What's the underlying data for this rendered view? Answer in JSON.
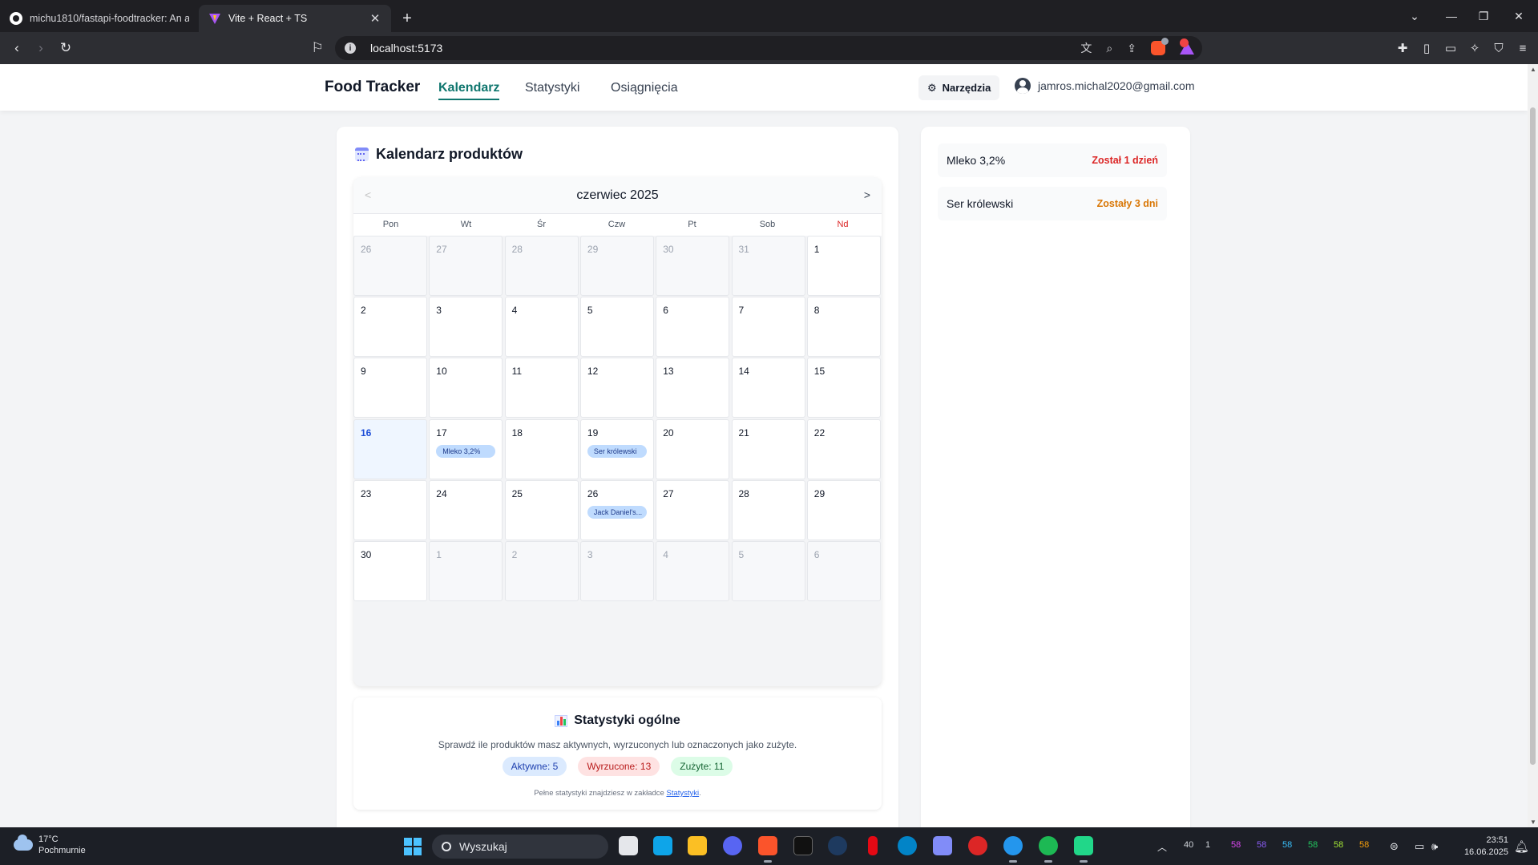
{
  "browser": {
    "tabs": [
      {
        "title": "michu1810/fastapi-foodtracker: An a",
        "active": false
      },
      {
        "title": "Vite + React + TS",
        "active": true
      }
    ],
    "new_tab": "+",
    "url": "localhost:5173"
  },
  "app": {
    "brand": "Food Tracker",
    "nav": [
      {
        "label": "Kalendarz",
        "active": true
      },
      {
        "label": "Statystyki",
        "active": false
      },
      {
        "label": "Osiągnięcia",
        "active": false
      }
    ],
    "tools_label": "Narzędzia",
    "user_email": "jamros.michal2020@gmail.com"
  },
  "calendar": {
    "title": "Kalendarz produktów",
    "month_label": "czerwiec 2025",
    "prev": "<",
    "next": ">",
    "weekdays": [
      "Pon",
      "Wt",
      "Śr",
      "Czw",
      "Pt",
      "Sob",
      "Nd"
    ],
    "weeks": [
      [
        {
          "d": "26",
          "o": true
        },
        {
          "d": "27",
          "o": true
        },
        {
          "d": "28",
          "o": true
        },
        {
          "d": "29",
          "o": true
        },
        {
          "d": "30",
          "o": true
        },
        {
          "d": "31",
          "o": true
        },
        {
          "d": "1"
        }
      ],
      [
        {
          "d": "2"
        },
        {
          "d": "3"
        },
        {
          "d": "4"
        },
        {
          "d": "5"
        },
        {
          "d": "6"
        },
        {
          "d": "7"
        },
        {
          "d": "8"
        }
      ],
      [
        {
          "d": "9"
        },
        {
          "d": "10"
        },
        {
          "d": "11"
        },
        {
          "d": "12"
        },
        {
          "d": "13"
        },
        {
          "d": "14"
        },
        {
          "d": "15"
        }
      ],
      [
        {
          "d": "16",
          "today": true
        },
        {
          "d": "17",
          "events": [
            "Mleko 3,2%"
          ]
        },
        {
          "d": "18"
        },
        {
          "d": "19",
          "events": [
            "Ser królewski"
          ]
        },
        {
          "d": "20"
        },
        {
          "d": "21"
        },
        {
          "d": "22"
        }
      ],
      [
        {
          "d": "23"
        },
        {
          "d": "24"
        },
        {
          "d": "25"
        },
        {
          "d": "26",
          "events": [
            "Jack Daniel's..."
          ]
        },
        {
          "d": "27"
        },
        {
          "d": "28"
        },
        {
          "d": "29"
        }
      ],
      [
        {
          "d": "30"
        },
        {
          "d": "1",
          "o": true
        },
        {
          "d": "2",
          "o": true
        },
        {
          "d": "3",
          "o": true
        },
        {
          "d": "4",
          "o": true
        },
        {
          "d": "5",
          "o": true
        },
        {
          "d": "6",
          "o": true
        }
      ]
    ]
  },
  "stats": {
    "title": "Statystyki ogólne",
    "description": "Sprawdź ile produktów masz aktywnych, wyrzuconych lub oznaczonych jako zużyte.",
    "active": "Aktywne: 5",
    "thrown": "Wyrzucone: 13",
    "used": "Zużyte: 11",
    "footer_prefix": "Pełne statystyki znajdziesz w zakładce ",
    "footer_link": "Statystyki",
    "footer_suffix": "."
  },
  "expiring": [
    {
      "name": "Mleko 3,2%",
      "status": "Został 1 dzień",
      "color": "#dc2626"
    },
    {
      "name": "Ser królewski",
      "status": "Zostały 3 dni",
      "color": "#d97706"
    }
  ],
  "taskbar": {
    "temperature": "17°C",
    "condition": "Pochmurnie",
    "search": "Wyszukaj",
    "tray_numbers": [
      "40",
      "1",
      "58",
      "58",
      "58",
      "58",
      "58",
      "58"
    ],
    "tray_colors": [
      "#d1d5db",
      "#d1d5db",
      "#d946ef",
      "#8b5cf6",
      "#38bdf8",
      "#22c55e",
      "#a3e635",
      "#f59e0b"
    ],
    "time": "23:51",
    "date": "16.06.2025"
  }
}
